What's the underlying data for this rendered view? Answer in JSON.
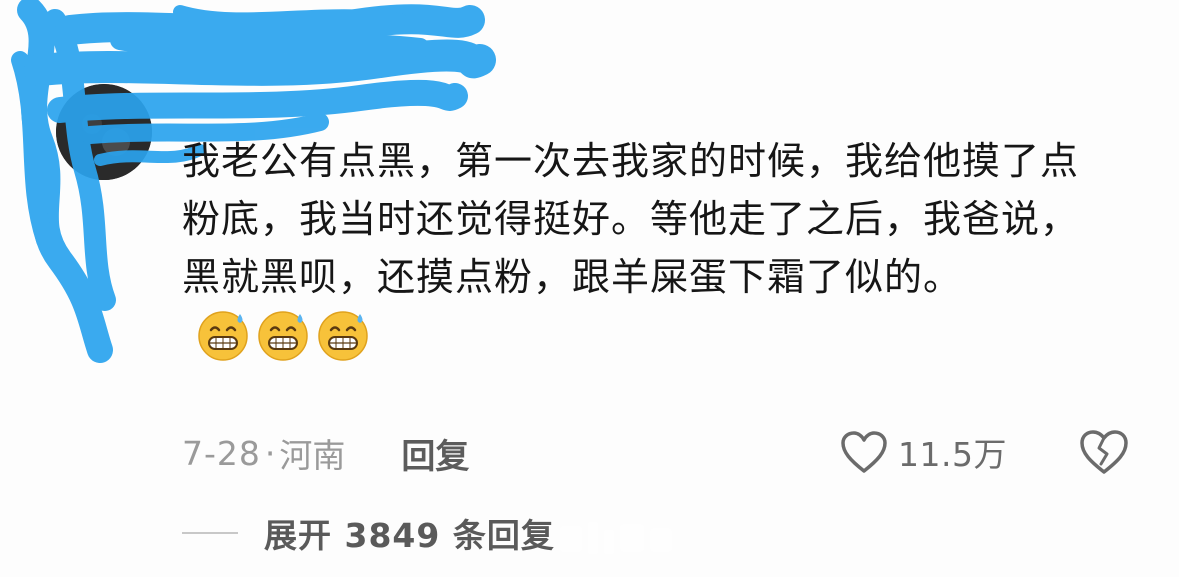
{
  "comment": {
    "text": "我老公有点黑，第一次去我家的时候，我给他摸了点粉底，我当时还觉得挺好。等他走了之后，我爸说，黑就黑呗，还摸点粉，跟羊屎蛋下霜了似的。",
    "emojis": [
      "grinning-sweat-emoji",
      "grinning-sweat-emoji",
      "grinning-sweat-emoji"
    ]
  },
  "meta": {
    "date": "7-28",
    "dot": "·",
    "location": "河南",
    "reply_label": "回复"
  },
  "actions": {
    "like_icon": "heart-outline-icon",
    "like_count": "11.5万",
    "dislike_icon": "broken-heart-icon"
  },
  "expand": {
    "label": "展开 3849 条回复"
  },
  "colors": {
    "redaction_blue": "#2aa3ee",
    "text_primary": "#161616",
    "text_secondary": "#9a9a9a",
    "emoji_yellow": "#f7c23a"
  }
}
